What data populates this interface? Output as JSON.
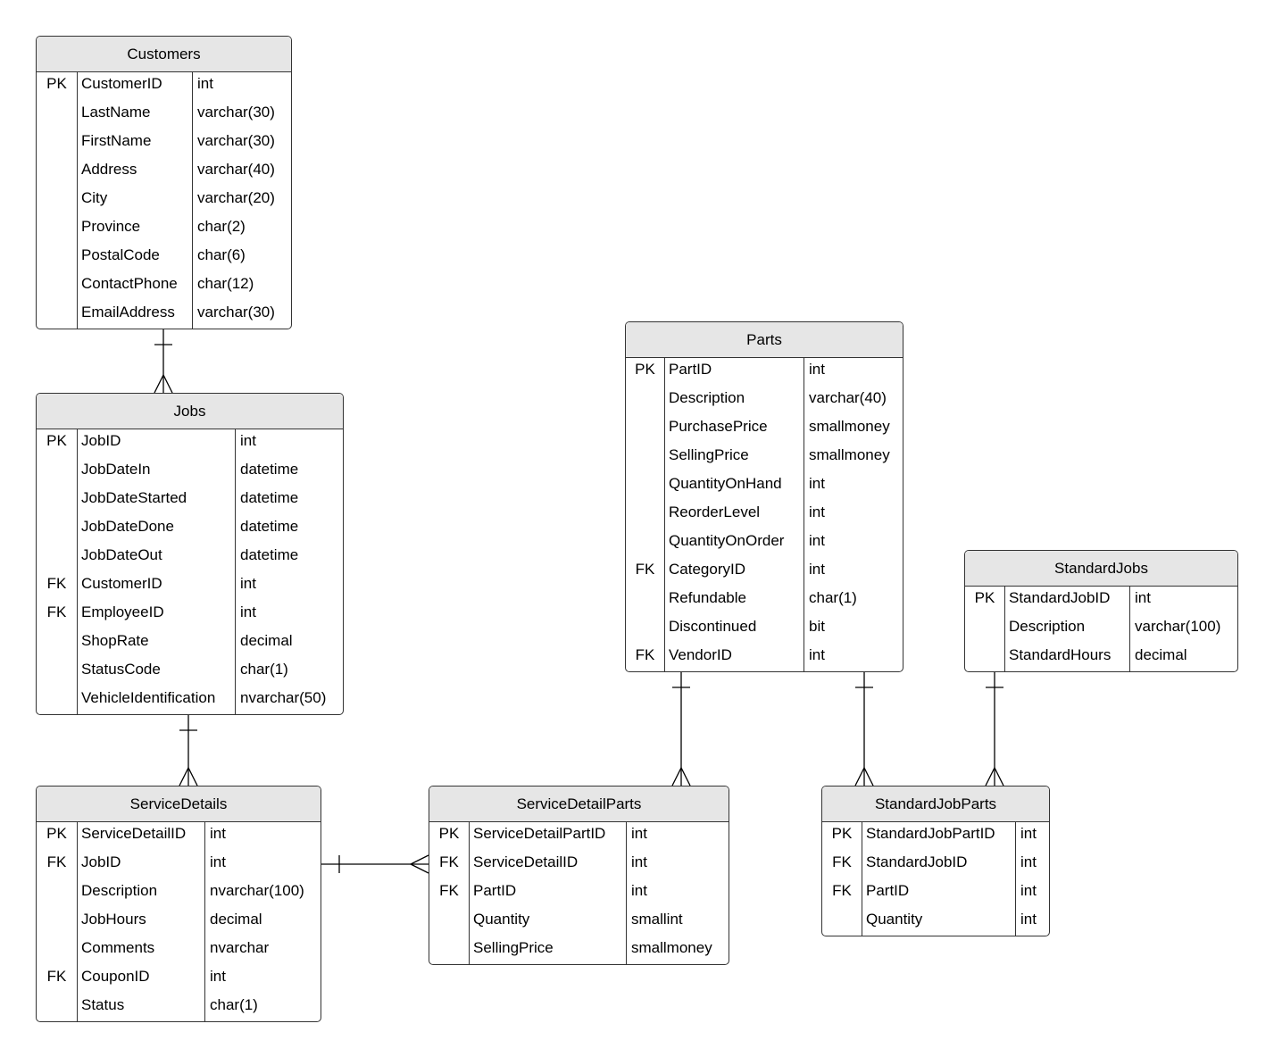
{
  "entities": [
    {
      "name": "Customers",
      "fields": [
        {
          "key": "PK",
          "name": "CustomerID",
          "type": "int"
        },
        {
          "key": "",
          "name": "LastName",
          "type": "varchar(30)"
        },
        {
          "key": "",
          "name": "FirstName",
          "type": "varchar(30)"
        },
        {
          "key": "",
          "name": "Address",
          "type": "varchar(40)"
        },
        {
          "key": "",
          "name": "City",
          "type": "varchar(20)"
        },
        {
          "key": "",
          "name": "Province",
          "type": "char(2)"
        },
        {
          "key": "",
          "name": "PostalCode",
          "type": "char(6)"
        },
        {
          "key": "",
          "name": "ContactPhone",
          "type": "char(12)"
        },
        {
          "key": "",
          "name": "EmailAddress",
          "type": "varchar(30)"
        }
      ]
    },
    {
      "name": "Jobs",
      "fields": [
        {
          "key": "PK",
          "name": "JobID",
          "type": "int"
        },
        {
          "key": "",
          "name": "JobDateIn",
          "type": "datetime"
        },
        {
          "key": "",
          "name": "JobDateStarted",
          "type": "datetime"
        },
        {
          "key": "",
          "name": "JobDateDone",
          "type": "datetime"
        },
        {
          "key": "",
          "name": "JobDateOut",
          "type": "datetime"
        },
        {
          "key": "FK",
          "name": "CustomerID",
          "type": "int"
        },
        {
          "key": "FK",
          "name": "EmployeeID",
          "type": "int"
        },
        {
          "key": "",
          "name": "ShopRate",
          "type": "decimal"
        },
        {
          "key": "",
          "name": "StatusCode",
          "type": "char(1)"
        },
        {
          "key": "",
          "name": "VehicleIdentification",
          "type": "nvarchar(50)"
        }
      ]
    },
    {
      "name": "ServiceDetails",
      "fields": [
        {
          "key": "PK",
          "name": "ServiceDetailID",
          "type": "int"
        },
        {
          "key": "FK",
          "name": "JobID",
          "type": "int"
        },
        {
          "key": "",
          "name": "Description",
          "type": "nvarchar(100)"
        },
        {
          "key": "",
          "name": "JobHours",
          "type": "decimal"
        },
        {
          "key": "",
          "name": "Comments",
          "type": "nvarchar"
        },
        {
          "key": "FK",
          "name": "CouponID",
          "type": "int"
        },
        {
          "key": "",
          "name": "Status",
          "type": "char(1)"
        }
      ]
    },
    {
      "name": "ServiceDetailParts",
      "fields": [
        {
          "key": "PK",
          "name": "ServiceDetailPartID",
          "type": "int"
        },
        {
          "key": "FK",
          "name": "ServiceDetailID",
          "type": "int"
        },
        {
          "key": "FK",
          "name": "PartID",
          "type": "int"
        },
        {
          "key": "",
          "name": "Quantity",
          "type": "smallint"
        },
        {
          "key": "",
          "name": "SellingPrice",
          "type": "smallmoney"
        }
      ]
    },
    {
      "name": "Parts",
      "fields": [
        {
          "key": "PK",
          "name": "PartID",
          "type": "int"
        },
        {
          "key": "",
          "name": "Description",
          "type": "varchar(40)"
        },
        {
          "key": "",
          "name": "PurchasePrice",
          "type": "smallmoney"
        },
        {
          "key": "",
          "name": "SellingPrice",
          "type": "smallmoney"
        },
        {
          "key": "",
          "name": "QuantityOnHand",
          "type": "int"
        },
        {
          "key": "",
          "name": "ReorderLevel",
          "type": "int"
        },
        {
          "key": "",
          "name": "QuantityOnOrder",
          "type": "int"
        },
        {
          "key": "FK",
          "name": "CategoryID",
          "type": "int"
        },
        {
          "key": "",
          "name": "Refundable",
          "type": "char(1)"
        },
        {
          "key": "",
          "name": "Discontinued",
          "type": "bit"
        },
        {
          "key": "FK",
          "name": "VendorID",
          "type": "int"
        }
      ]
    },
    {
      "name": "StandardJobs",
      "fields": [
        {
          "key": "PK",
          "name": "StandardJobID",
          "type": "int"
        },
        {
          "key": "",
          "name": "Description",
          "type": "varchar(100)"
        },
        {
          "key": "",
          "name": "StandardHours",
          "type": "decimal"
        }
      ]
    },
    {
      "name": "StandardJobParts",
      "fields": [
        {
          "key": "PK",
          "name": "StandardJobPartID",
          "type": "int"
        },
        {
          "key": "FK",
          "name": "StandardJobID",
          "type": "int"
        },
        {
          "key": "FK",
          "name": "PartID",
          "type": "int"
        },
        {
          "key": "",
          "name": "Quantity",
          "type": "int"
        }
      ]
    }
  ],
  "relationships": [
    {
      "from": "Customers",
      "to": "Jobs",
      "cardinality": "one-to-many"
    },
    {
      "from": "Jobs",
      "to": "ServiceDetails",
      "cardinality": "one-to-many"
    },
    {
      "from": "ServiceDetails",
      "to": "ServiceDetailParts",
      "cardinality": "one-to-many"
    },
    {
      "from": "Parts",
      "to": "ServiceDetailParts",
      "cardinality": "one-to-many"
    },
    {
      "from": "Parts",
      "to": "StandardJobParts",
      "cardinality": "one-to-many"
    },
    {
      "from": "StandardJobs",
      "to": "StandardJobParts",
      "cardinality": "one-to-many"
    }
  ],
  "colors": {
    "header": "#e6e6e6",
    "border": "#333333",
    "line": "#000000"
  }
}
